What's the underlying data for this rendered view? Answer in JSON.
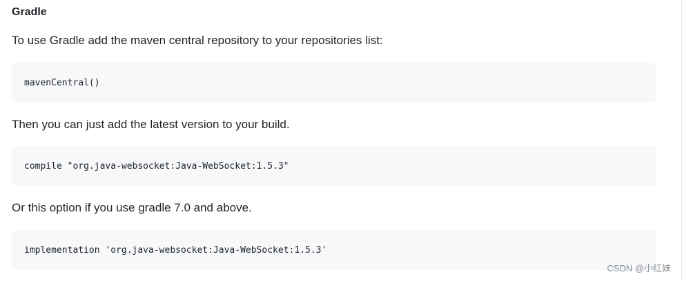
{
  "heading": "Gradle",
  "intro": "To use Gradle add the maven central repository to your repositories list:",
  "code1": "mavenCentral()",
  "then_text": "Then you can just add the latest version to your build.",
  "code2": "compile \"org.java-websocket:Java-WebSocket:1.5.3\"",
  "or_text": "Or this option if you use gradle 7.0 and above.",
  "code3": "implementation 'org.java-websocket:Java-WebSocket:1.5.3'",
  "watermark": "CSDN @小红妹"
}
